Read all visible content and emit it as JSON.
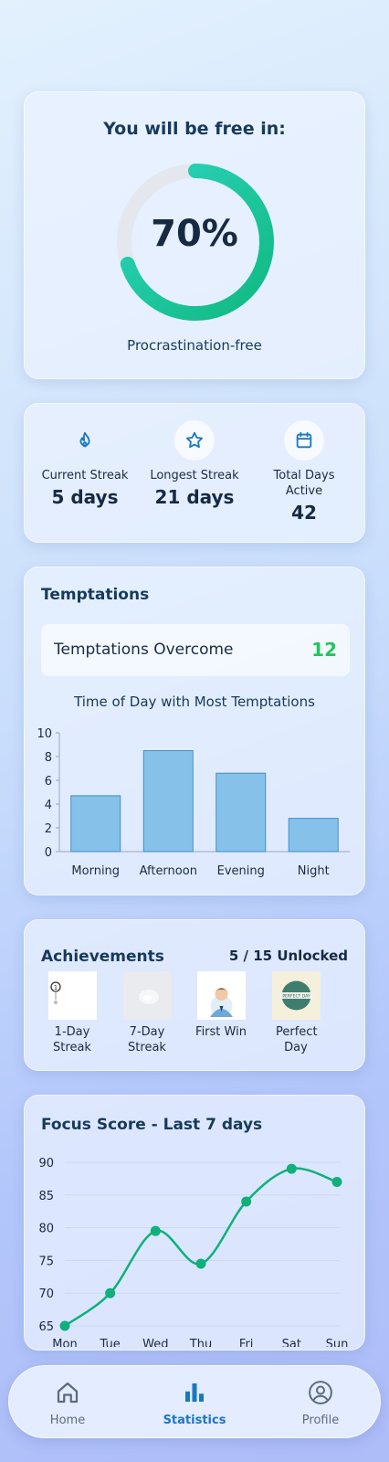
{
  "progress": {
    "title": "You will be free in:",
    "percent_label": "70%",
    "percent_value": 0.7,
    "caption": "Procrastination-free",
    "colors": {
      "track": "#e4e8ee",
      "start": "#10b981",
      "end": "#2dd4bf"
    }
  },
  "stats": [
    {
      "icon": "flame-icon",
      "label": "Current Streak",
      "value": "5 days"
    },
    {
      "icon": "star-icon",
      "label": "Longest Streak",
      "value": "21 days"
    },
    {
      "icon": "calendar-icon",
      "label": "Total Days Active",
      "value": "42"
    }
  ],
  "temptations": {
    "title": "Temptations",
    "overcome_label": "Temptations Overcome",
    "overcome_value": "12",
    "overcome_color": "#22c55e",
    "chart_title": "Time of Day with Most Temptations"
  },
  "achievements": {
    "title": "Achievements",
    "count": "5 / 15 Unlocked",
    "badges": [
      {
        "label": "1-Day Streak",
        "icon": "one-day-badge-icon"
      },
      {
        "label": "7-Day Streak",
        "icon": "seven-day-badge-icon"
      },
      {
        "label": "First Win",
        "icon": "first-win-badge-icon"
      },
      {
        "label": "Perfect Day",
        "icon": "perfect-day-badge-icon",
        "badge_text": "PERFECT DAY"
      }
    ]
  },
  "focus": {
    "title": "Focus Score - Last 7 days"
  },
  "nav": {
    "items": [
      {
        "label": "Home",
        "icon": "home-icon",
        "active": false
      },
      {
        "label": "Statistics",
        "icon": "bar-chart-icon",
        "active": true
      },
      {
        "label": "Profile",
        "icon": "profile-icon",
        "active": false
      }
    ],
    "active_color": "#1a78c2",
    "inactive_color": "#5b6b80"
  },
  "chart_data": [
    {
      "type": "bar",
      "title": "Time of Day with Most Temptations",
      "categories": [
        "Morning",
        "Afternoon",
        "Evening",
        "Night"
      ],
      "values": [
        4.7,
        8.5,
        6.6,
        2.8
      ],
      "ylim": [
        0,
        10
      ],
      "yticks": [
        0,
        2,
        4,
        6,
        8,
        10
      ],
      "bar_color": "#86c1ea",
      "bar_stroke": "#3d8fc9"
    },
    {
      "type": "line",
      "title": "Focus Score - Last 7 days",
      "categories": [
        "Mon",
        "Tue",
        "Wed",
        "Thu",
        "Fri",
        "Sat",
        "Sun"
      ],
      "values": [
        65,
        70,
        79.5,
        74.5,
        84,
        89,
        87
      ],
      "ylim": [
        65,
        90
      ],
      "yticks": [
        65,
        70,
        75,
        80,
        85,
        90
      ],
      "line_color": "#10b07a",
      "grid": true
    }
  ]
}
